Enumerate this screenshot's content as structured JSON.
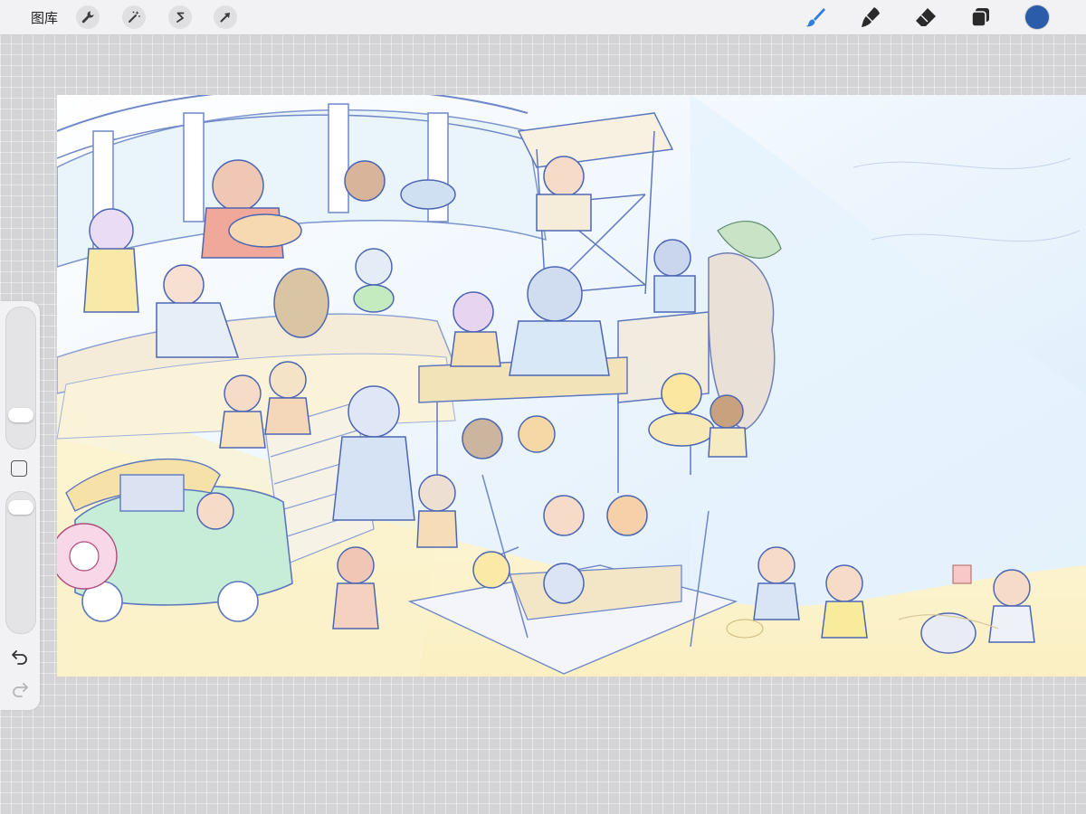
{
  "toolbar": {
    "gallery_label": "图库",
    "left_tools": [
      {
        "name": "actions",
        "icon": "wrench-icon"
      },
      {
        "name": "adjustments",
        "icon": "magic-wand-icon"
      },
      {
        "name": "selection",
        "icon": "selection-s-icon"
      },
      {
        "name": "transform",
        "icon": "arrow-cursor-icon"
      }
    ],
    "right_tools": [
      {
        "name": "brush",
        "icon": "brush-icon",
        "active": true
      },
      {
        "name": "smudge",
        "icon": "smudge-icon"
      },
      {
        "name": "eraser",
        "icon": "eraser-icon"
      },
      {
        "name": "layers",
        "icon": "layers-icon"
      }
    ],
    "active_color": "#2a5caa",
    "accent_color": "#2f7de1"
  },
  "sidebar": {
    "brush_size_level": 0.2,
    "opacity_level": 0.95,
    "modify_icon": "square-icon",
    "undo_icon": "undo-icon",
    "redo_icon": "redo-icon"
  },
  "canvas": {
    "content": "illustration-sketch"
  }
}
